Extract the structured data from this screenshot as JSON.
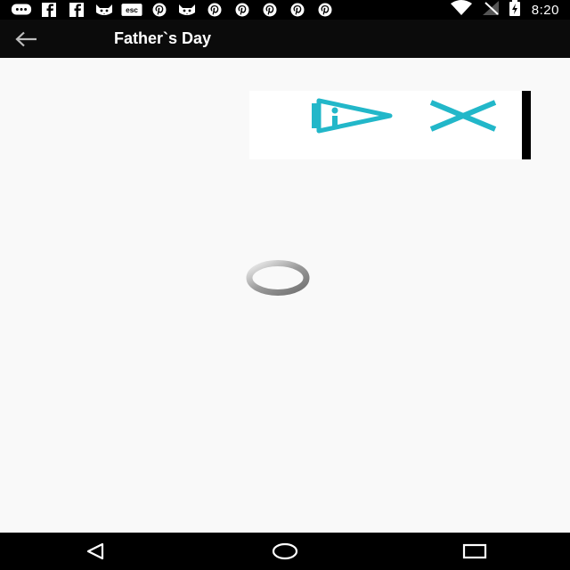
{
  "status_bar": {
    "notifications": [
      "messages-icon",
      "facebook-icon",
      "facebook-icon",
      "cat-app-icon",
      "esc-icon",
      "pinterest-icon",
      "cat-app-icon",
      "pinterest-icon",
      "pinterest-icon",
      "pinterest-icon",
      "pinterest-icon",
      "pinterest-icon"
    ],
    "esc_label": "esc",
    "time": "8:20"
  },
  "app_bar": {
    "title": "Father`s Day",
    "background": "#0b0b0b"
  },
  "ad": {
    "accent": "#22b7c9"
  },
  "nav_bar": {
    "buttons": [
      "back",
      "home",
      "recents"
    ]
  }
}
